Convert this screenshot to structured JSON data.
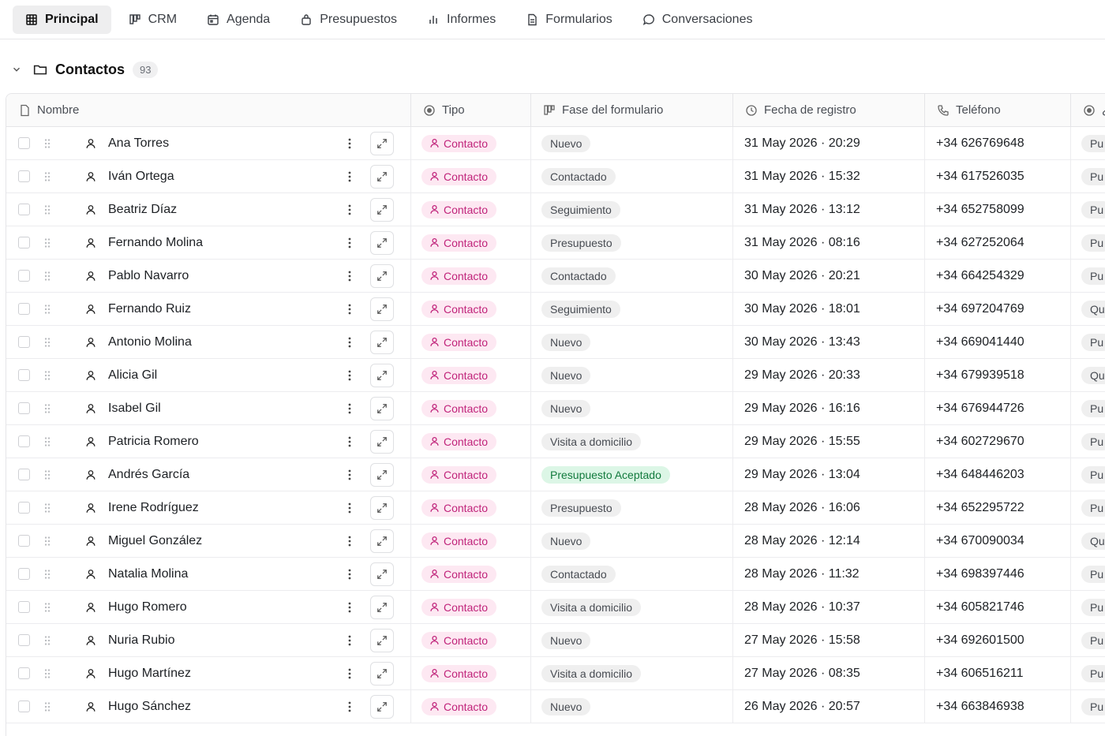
{
  "nav": {
    "tabs": [
      {
        "label": "Principal",
        "icon": "grid-icon",
        "active": true
      },
      {
        "label": "CRM",
        "icon": "kanban-icon",
        "active": false
      },
      {
        "label": "Agenda",
        "icon": "calendar-icon",
        "active": false
      },
      {
        "label": "Presupuestos",
        "icon": "bag-icon",
        "active": false
      },
      {
        "label": "Informes",
        "icon": "bar-chart-icon",
        "active": false
      },
      {
        "label": "Formularios",
        "icon": "document-icon",
        "active": false
      },
      {
        "label": "Conversaciones",
        "icon": "chat-icon",
        "active": false
      }
    ]
  },
  "section": {
    "title": "Contactos",
    "count": "93"
  },
  "columns": {
    "nombre": "Nombre",
    "tipo": "Tipo",
    "fase": "Fase del formulario",
    "fecha": "Fecha de registro",
    "telefono": "Teléfono",
    "next": "¿"
  },
  "rows": [
    {
      "name": "Ana Torres",
      "tipo": "Contacto",
      "fase": "Nuevo",
      "fecha": "31 May 2026 · 20:29",
      "tel": "+34 626769648",
      "next": "Pu"
    },
    {
      "name": "Iván Ortega",
      "tipo": "Contacto",
      "fase": "Contactado",
      "fecha": "31 May 2026 · 15:32",
      "tel": "+34 617526035",
      "next": "Pu"
    },
    {
      "name": "Beatriz Díaz",
      "tipo": "Contacto",
      "fase": "Seguimiento",
      "fecha": "31 May 2026 · 13:12",
      "tel": "+34 652758099",
      "next": "Pu"
    },
    {
      "name": "Fernando Molina",
      "tipo": "Contacto",
      "fase": "Presupuesto",
      "fecha": "31 May 2026 · 08:16",
      "tel": "+34 627252064",
      "next": "Pu"
    },
    {
      "name": "Pablo Navarro",
      "tipo": "Contacto",
      "fase": "Contactado",
      "fecha": "30 May 2026 · 20:21",
      "tel": "+34 664254329",
      "next": "Pu"
    },
    {
      "name": "Fernando Ruiz",
      "tipo": "Contacto",
      "fase": "Seguimiento",
      "fecha": "30 May 2026 · 18:01",
      "tel": "+34 697204769",
      "next": "Qu"
    },
    {
      "name": "Antonio Molina",
      "tipo": "Contacto",
      "fase": "Nuevo",
      "fecha": "30 May 2026 · 13:43",
      "tel": "+34 669041440",
      "next": "Pu"
    },
    {
      "name": "Alicia Gil",
      "tipo": "Contacto",
      "fase": "Nuevo",
      "fecha": "29 May 2026 · 20:33",
      "tel": "+34 679939518",
      "next": "Qu"
    },
    {
      "name": "Isabel Gil",
      "tipo": "Contacto",
      "fase": "Nuevo",
      "fecha": "29 May 2026 · 16:16",
      "tel": "+34 676944726",
      "next": "Pu"
    },
    {
      "name": "Patricia Romero",
      "tipo": "Contacto",
      "fase": "Visita a domicilio",
      "fecha": "29 May 2026 · 15:55",
      "tel": "+34 602729670",
      "next": "Pu"
    },
    {
      "name": "Andrés García",
      "tipo": "Contacto",
      "fase": "Presupuesto Aceptado",
      "fecha": "29 May 2026 · 13:04",
      "tel": "+34 648446203",
      "next": "Pu"
    },
    {
      "name": "Irene Rodríguez",
      "tipo": "Contacto",
      "fase": "Presupuesto",
      "fecha": "28 May 2026 · 16:06",
      "tel": "+34 652295722",
      "next": "Pu"
    },
    {
      "name": "Miguel González",
      "tipo": "Contacto",
      "fase": "Nuevo",
      "fecha": "28 May 2026 · 12:14",
      "tel": "+34 670090034",
      "next": "Qu"
    },
    {
      "name": "Natalia Molina",
      "tipo": "Contacto",
      "fase": "Contactado",
      "fecha": "28 May 2026 · 11:32",
      "tel": "+34 698397446",
      "next": "Pu"
    },
    {
      "name": "Hugo Romero",
      "tipo": "Contacto",
      "fase": "Visita a domicilio",
      "fecha": "28 May 2026 · 10:37",
      "tel": "+34 605821746",
      "next": "Pu"
    },
    {
      "name": "Nuria Rubio",
      "tipo": "Contacto",
      "fase": "Nuevo",
      "fecha": "27 May 2026 · 15:58",
      "tel": "+34 692601500",
      "next": "Pu"
    },
    {
      "name": "Hugo Martínez",
      "tipo": "Contacto",
      "fase": "Visita a domicilio",
      "fecha": "27 May 2026 · 08:35",
      "tel": "+34 606516211",
      "next": "Pu"
    },
    {
      "name": "Hugo Sánchez",
      "tipo": "Contacto",
      "fase": "Nuevo",
      "fecha": "26 May 2026 · 20:57",
      "tel": "+34 663846938",
      "next": "Pu"
    }
  ],
  "colors": {
    "tipo_bg": "#fde8f2",
    "tipo_text": "#c0237a",
    "accepted_bg": "#dcf6e6",
    "accepted_text": "#127a3d"
  }
}
